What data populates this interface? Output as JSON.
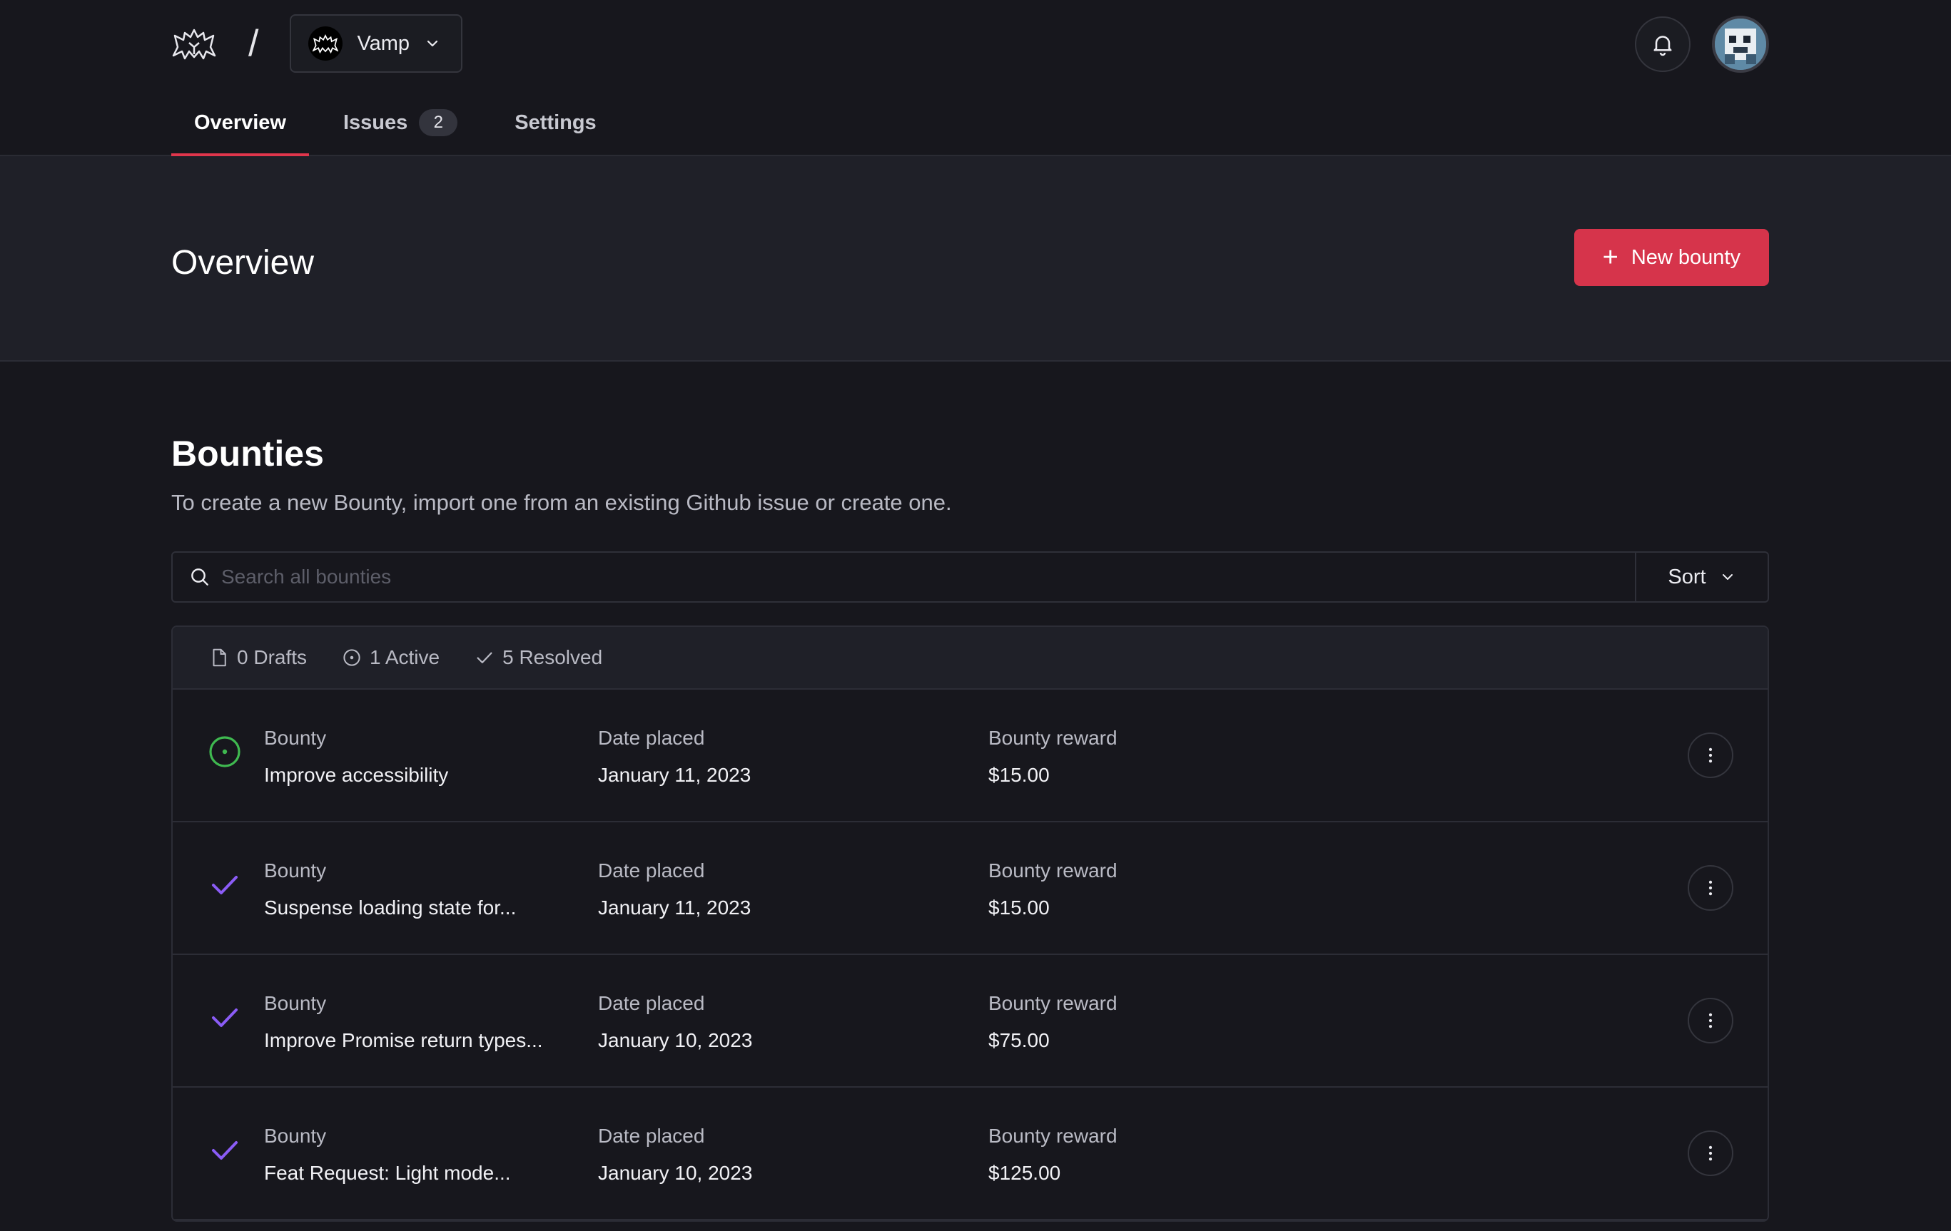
{
  "header": {
    "org_name": "Vamp",
    "tabs": [
      {
        "label": "Overview"
      },
      {
        "label": "Issues",
        "count": "2"
      },
      {
        "label": "Settings"
      }
    ]
  },
  "overview": {
    "title": "Overview",
    "new_bounty_label": "New bounty"
  },
  "bounties": {
    "title": "Bounties",
    "description": "To create a new Bounty, import one from an existing Github issue or create one.",
    "search_placeholder": "Search all bounties",
    "sort_label": "Sort",
    "filters": {
      "drafts": "0 Drafts",
      "active": "1 Active",
      "resolved": "5 Resolved"
    },
    "rows": [
      {
        "status": "active",
        "title_label": "Bounty",
        "title": "Improve accessibility",
        "date_label": "Date placed",
        "date": "January 11, 2023",
        "reward_label": "Bounty reward",
        "reward": "$15.00"
      },
      {
        "status": "resolved",
        "title_label": "Bounty",
        "title": "Suspense loading state for...",
        "date_label": "Date placed",
        "date": "January 11, 2023",
        "reward_label": "Bounty reward",
        "reward": "$15.00"
      },
      {
        "status": "resolved",
        "title_label": "Bounty",
        "title": "Improve Promise return types...",
        "date_label": "Date placed",
        "date": "January 10, 2023",
        "reward_label": "Bounty reward",
        "reward": "$75.00"
      },
      {
        "status": "resolved",
        "title_label": "Bounty",
        "title": "Feat Request: Light mode...",
        "date_label": "Date placed",
        "date": "January 10, 2023",
        "reward_label": "Bounty reward",
        "reward": "$125.00"
      }
    ]
  },
  "colors": {
    "accent": "#d6344b",
    "active_status": "#3fb950",
    "resolved_status": "#8b5cf6",
    "background": "#17171d"
  }
}
